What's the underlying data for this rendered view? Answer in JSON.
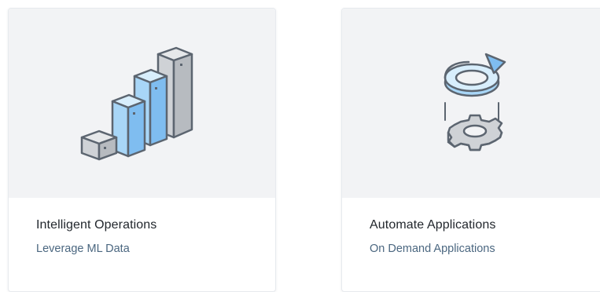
{
  "cards": [
    {
      "icon": "server-bars-icon",
      "title": "Intelligent Operations",
      "subtitle": "Leverage ML Data"
    },
    {
      "icon": "refresh-gear-icon",
      "title": "Automate Applications",
      "subtitle": "On Demand Applications"
    }
  ],
  "colors": {
    "card_art_bg": "#f2f3f5",
    "title_text": "#22272d",
    "subtitle_text": "#4b6780",
    "accent_blue": "#8ec8f5",
    "icon_grey": "#c9ccd0",
    "outline": "#5c6570"
  }
}
